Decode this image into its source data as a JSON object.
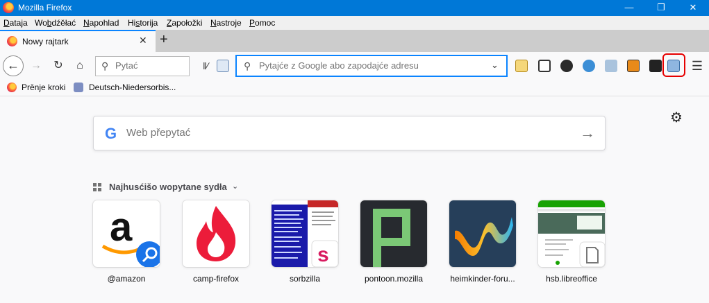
{
  "window": {
    "title": "Mozilla Firefox"
  },
  "menu": [
    {
      "pre": "",
      "acc": "D",
      "post": "ataja"
    },
    {
      "pre": "Wo",
      "acc": "b",
      "post": "dźěłać"
    },
    {
      "pre": "",
      "acc": "N",
      "post": "apohlad"
    },
    {
      "pre": "Hi",
      "acc": "s",
      "post": "torija"
    },
    {
      "pre": "",
      "acc": "Z",
      "post": "apołožki"
    },
    {
      "pre": "",
      "acc": "N",
      "post": "astroje"
    },
    {
      "pre": "",
      "acc": "P",
      "post": "omoc"
    }
  ],
  "tab": {
    "label": "Nowy rajtark",
    "close": "✕"
  },
  "newtab": "+",
  "toolbar": {
    "search_placeholder": "Pytać",
    "url_placeholder": "Pytajće z Google abo zapodajće adresu"
  },
  "bookmarks": [
    {
      "label": "Prěnje kroki"
    },
    {
      "label": "Deutsch-Niedersorbis..."
    }
  ],
  "newtab_page": {
    "web_search_placeholder": "Web přepytać",
    "topsites_title": "Najhusćišo wopytane sydła",
    "sites": [
      {
        "label": "@amazon"
      },
      {
        "label": "camp-firefox"
      },
      {
        "label": "sorbzilla"
      },
      {
        "label": "pontoon.mozilla"
      },
      {
        "label": "heimkinder-foru..."
      },
      {
        "label": "hsb.libreoffice"
      }
    ]
  },
  "colors": {
    "titlebar": "#0078d7",
    "accent": "#0a84ff",
    "highlight": "#e60000"
  }
}
